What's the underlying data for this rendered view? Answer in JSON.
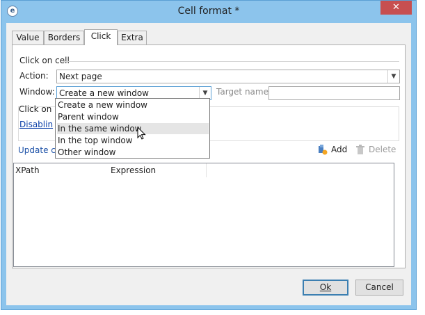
{
  "window": {
    "title": "Cell format *",
    "close_glyph": "✕"
  },
  "tabs": [
    {
      "label": "Value"
    },
    {
      "label": "Borders"
    },
    {
      "label": "Click"
    },
    {
      "label": "Extra"
    }
  ],
  "click_section": {
    "title": "Click on cell",
    "action_label": "Action:",
    "action_value": "Next page",
    "window_label": "Window:",
    "window_value": "Create a new window",
    "target_label": "Target name:",
    "target_value": ""
  },
  "sub_group": {
    "title": "Click on",
    "link": "Disablin"
  },
  "toolbar": {
    "update_link": "Update c",
    "add_label": "Add",
    "delete_label": "Delete"
  },
  "grid": {
    "columns": [
      "XPath",
      "Expression"
    ]
  },
  "dropdown": {
    "options": [
      "Create a new window",
      "Parent window",
      "In the same window",
      "In the top window",
      "Other window"
    ],
    "hovered": "In the same window"
  },
  "buttons": {
    "ok": "Ok",
    "cancel": "Cancel"
  },
  "colors": {
    "title_bg": "#8cc4ec",
    "close_bg": "#c74f50",
    "link": "#0a3ea8",
    "default_button_border": "#3c7fb1"
  }
}
